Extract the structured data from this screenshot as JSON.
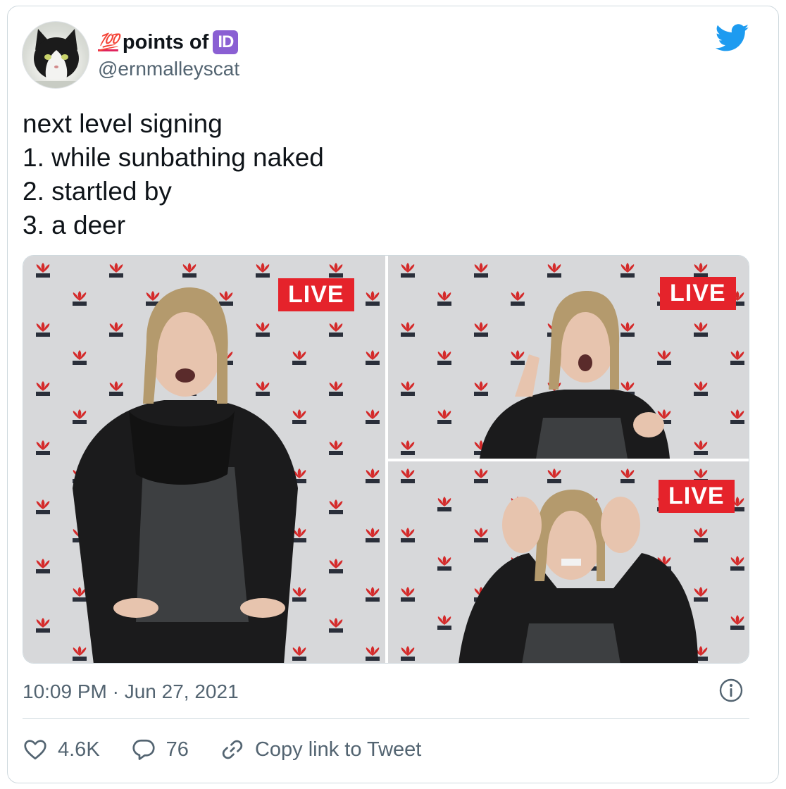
{
  "author": {
    "emoji_prefix": "💯",
    "display_name": "points of",
    "emoji_suffix": "ID",
    "handle": "@ernmalleyscat",
    "avatar_icon": "cat-avatar"
  },
  "tweet": {
    "lines": [
      "next level signing",
      "1. while sunbathing naked",
      "2. startled by",
      "3. a deer"
    ]
  },
  "media": {
    "photos": [
      {
        "live_label": "LIVE",
        "backdrop_logo": "NSW"
      },
      {
        "live_label": "LIVE",
        "backdrop_logo": "NSW"
      },
      {
        "live_label": "LIVE",
        "backdrop_logo": "NSW"
      }
    ]
  },
  "meta": {
    "timestamp": "10:09 PM · Jun 27, 2021"
  },
  "actions": {
    "likes": "4.6K",
    "replies": "76",
    "copy_link": "Copy link to Tweet"
  },
  "colors": {
    "twitter_blue": "#1d9bf0",
    "live_red": "#e5232b",
    "text_secondary": "#536471",
    "border": "#cfd9de"
  }
}
